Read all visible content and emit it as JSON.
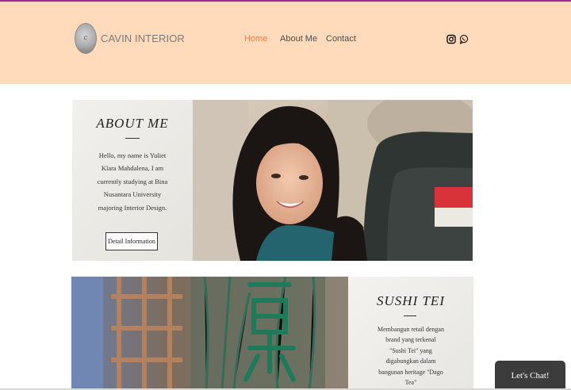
{
  "brand": {
    "name": "CAVIN INTERIOR",
    "logo_mark": "C"
  },
  "nav": {
    "items": [
      {
        "label": "Home",
        "active": true
      },
      {
        "label": "About Me",
        "active": false
      },
      {
        "label": "Contact",
        "active": false
      }
    ]
  },
  "social": {
    "icons": [
      "instagram-icon",
      "whatsapp-icon"
    ]
  },
  "about": {
    "title": "ABOUT ME",
    "body": "Hello, my name is Yuliet Klara Mahdalena, I am currently studying at Bina Nusantara University majoring Interior Design.",
    "button_label": "Detail Information"
  },
  "project": {
    "title": "SUSHI TEI",
    "body": "Membangun retail dengan brand yang terkenal \"Sushi Tei\" yang digabungkan dalam bangunan heritage \"Dago Tea\""
  },
  "chat": {
    "label": "Let's Chat!"
  },
  "colors": {
    "header_bg": "#ffdbbb",
    "accent": "#f07f4a",
    "top_line": "#a02a9c",
    "chat_bg": "#3c3c3c"
  }
}
